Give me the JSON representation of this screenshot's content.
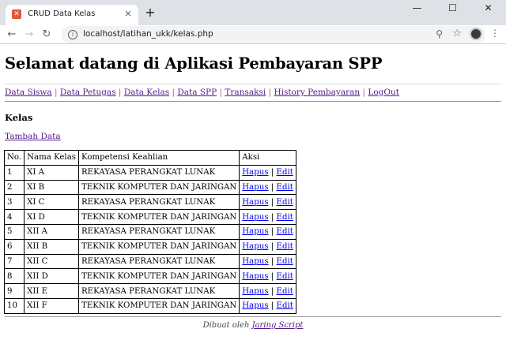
{
  "browser": {
    "tab_title": "CRUD Data Kelas",
    "url": "localhost/latihan_ukk/kelas.php",
    "new_tab": "+",
    "close_tab": "×",
    "minimize": "—",
    "maximize": "☐",
    "close_window": "✕"
  },
  "page": {
    "heading": "Selamat datang di Aplikasi Pembayaran SPP",
    "nav": [
      "Data Siswa",
      "Data Petugas",
      "Data Kelas",
      "Data SPP",
      "Transaksi",
      "History Pembayaran",
      "LogOut"
    ],
    "section_title": "Kelas",
    "add_link": "Tambah Data",
    "table": {
      "headers": [
        "No.",
        "Nama Kelas",
        "Kompetensi Keahlian",
        "Aksi"
      ],
      "rows": [
        {
          "no": "1",
          "nama": "XI A",
          "kompetensi": "REKAYASA PERANGKAT LUNAK"
        },
        {
          "no": "2",
          "nama": "XI B",
          "kompetensi": "TEKNIK KOMPUTER DAN JARINGAN"
        },
        {
          "no": "3",
          "nama": "XI C",
          "kompetensi": "REKAYASA PERANGKAT LUNAK"
        },
        {
          "no": "4",
          "nama": "XI D",
          "kompetensi": "TEKNIK KOMPUTER DAN JARINGAN"
        },
        {
          "no": "5",
          "nama": "XII A",
          "kompetensi": "REKAYASA PERANGKAT LUNAK"
        },
        {
          "no": "6",
          "nama": "XII B",
          "kompetensi": "TEKNIK KOMPUTER DAN JARINGAN"
        },
        {
          "no": "7",
          "nama": "XII C",
          "kompetensi": "REKAYASA PERANGKAT LUNAK"
        },
        {
          "no": "8",
          "nama": "XII D",
          "kompetensi": "TEKNIK KOMPUTER DAN JARINGAN"
        },
        {
          "no": "9",
          "nama": "XII E",
          "kompetensi": "REKAYASA PERANGKAT LUNAK"
        },
        {
          "no": "10",
          "nama": "XII F",
          "kompetensi": "TEKNIK KOMPUTER DAN JARINGAN"
        }
      ],
      "action_delete": "Hapus",
      "action_edit": "Edit",
      "action_separator": "|"
    },
    "footer_text": "Dibuat oleh",
    "footer_link": "Jaring Script"
  },
  "colors": {
    "link_visited": "#551a8b",
    "link": "#0000ee",
    "favicon": "#e0573b"
  }
}
